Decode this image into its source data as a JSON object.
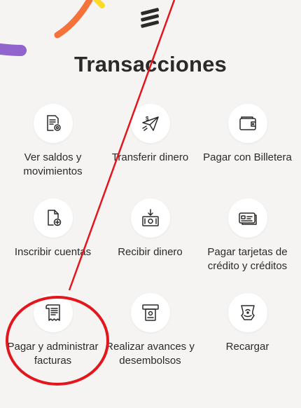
{
  "header": {
    "title": "Transacciones"
  },
  "colors": {
    "background": "#f5f4f3",
    "text": "#2c2a29",
    "deco_orange": "#f5733a",
    "deco_purple": "#9063cd",
    "deco_yellow": "#fdda24",
    "annotation_red": "#e3151d"
  },
  "tiles": [
    {
      "label": "Ver saldos y\nmovimientos",
      "icon": "document-search-icon"
    },
    {
      "label": "Transferir dinero",
      "icon": "send-money-icon"
    },
    {
      "label": "Pagar con Billetera",
      "icon": "wallet-icon"
    },
    {
      "label": "Inscribir cuentas",
      "icon": "add-document-icon"
    },
    {
      "label": "Recibir dinero",
      "icon": "receive-money-icon"
    },
    {
      "label": "Pagar tarjetas de\ncrédito y créditos",
      "icon": "credit-card-icon"
    },
    {
      "label": "Pagar y administrar\nfacturas",
      "icon": "invoice-icon"
    },
    {
      "label": "Realizar avances y\ndesembolsos",
      "icon": "atm-cash-icon"
    },
    {
      "label": "Recargar",
      "icon": "mobile-recharge-icon"
    }
  ]
}
